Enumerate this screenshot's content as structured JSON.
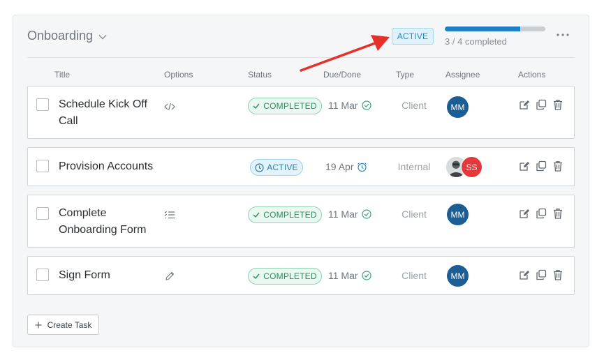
{
  "section": {
    "title": "Onboarding",
    "status": "ACTIVE"
  },
  "progress": {
    "completed": 3,
    "total": 4,
    "fraction": 0.75,
    "text": "3 / 4 completed"
  },
  "columns": {
    "title": "Title",
    "options": "Options",
    "status": "Status",
    "due": "Due/Done",
    "type": "Type",
    "assignee": "Assignee",
    "actions": "Actions"
  },
  "tasks": [
    {
      "title": "Schedule Kick Off Call",
      "option_icon": "code-icon",
      "status": "COMPLETED",
      "due": "11 Mar",
      "due_icon": "check-circle-icon",
      "type": "Client",
      "assignees": [
        "MM"
      ]
    },
    {
      "title": "Provision Accounts",
      "option_icon": "",
      "status": "ACTIVE",
      "due": "19 Apr",
      "due_icon": "alarm-clock-icon",
      "type": "Internal",
      "assignees": [
        "photo",
        "SS"
      ]
    },
    {
      "title": "Complete Onboarding Form",
      "option_icon": "list-icon",
      "status": "COMPLETED",
      "due": "11 Mar",
      "due_icon": "check-circle-icon",
      "type": "Client",
      "assignees": [
        "MM"
      ]
    },
    {
      "title": "Sign Form",
      "option_icon": "pencil-icon",
      "status": "COMPLETED",
      "due": "11 Mar",
      "due_icon": "check-circle-icon",
      "type": "Client",
      "assignees": [
        "MM"
      ]
    }
  ],
  "create_button": {
    "label": "Create Task"
  },
  "colors": {
    "accent": "#1f80c9",
    "completed": "#2f8a5f",
    "active": "#2b7fae",
    "avatar_mm": "#1c5e93",
    "avatar_ss": "#e3393d",
    "annotation_arrow": "#e8302a"
  }
}
